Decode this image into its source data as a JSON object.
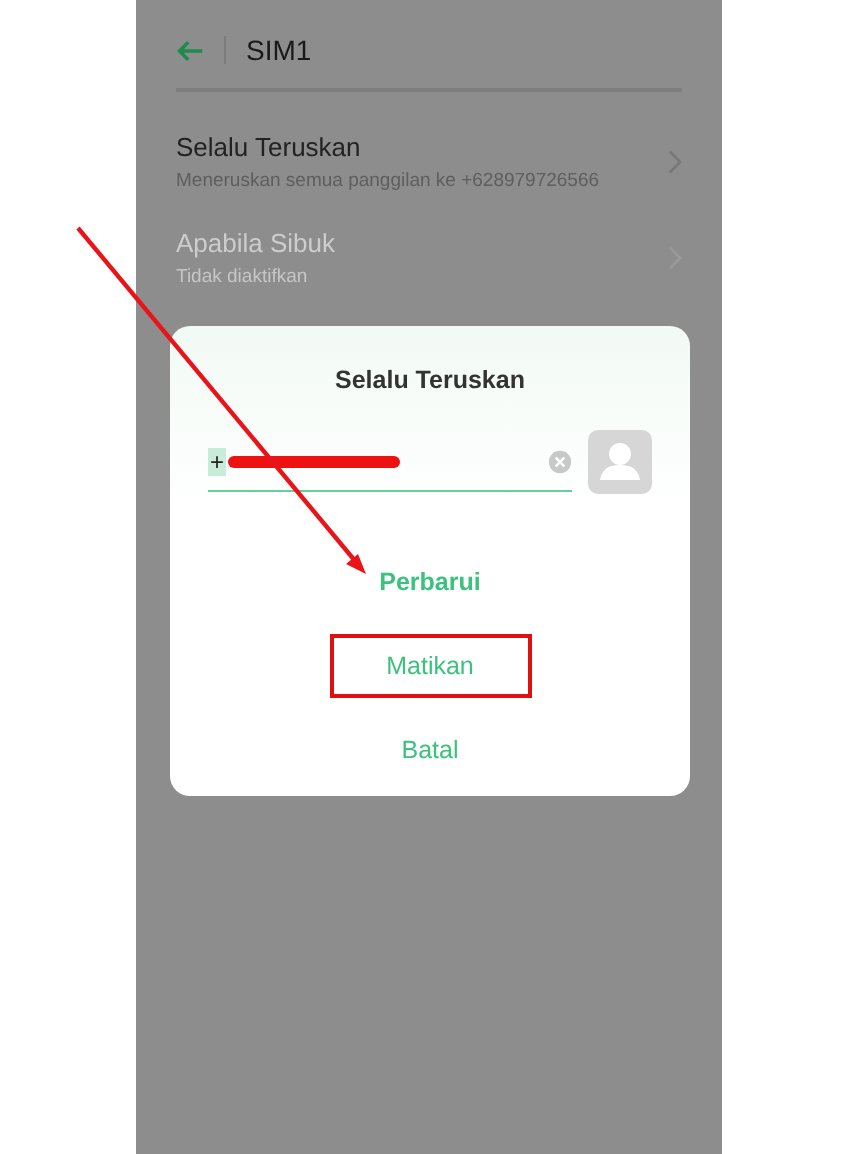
{
  "header": {
    "title": "SIM1"
  },
  "settings": [
    {
      "title": "Selalu Teruskan",
      "subtitle": "Meneruskan semua panggilan ke +628979726566",
      "disabled": false
    },
    {
      "title": "Apabila Sibuk",
      "subtitle": "Tidak diaktifkan",
      "disabled": true
    }
  ],
  "dialog": {
    "title": "Selalu Teruskan",
    "field": {
      "value": "+",
      "redacted": true
    },
    "actions": [
      {
        "label": "Perbarui",
        "kind": "primary",
        "highlighted": false
      },
      {
        "label": "Matikan",
        "kind": "plain",
        "highlighted": true
      },
      {
        "label": "Batal",
        "kind": "plain",
        "highlighted": false
      }
    ]
  },
  "annotation": {
    "kind": "arrow"
  }
}
